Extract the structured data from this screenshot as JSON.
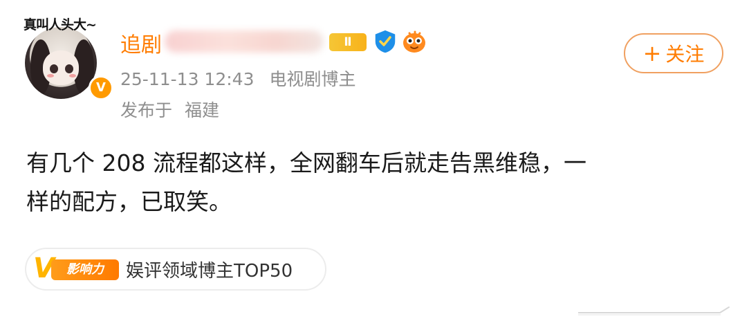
{
  "author": {
    "avatar_caption": "真叫人头大~",
    "verified_mark": "V",
    "name": "追剧",
    "level_badge": "Ⅱ",
    "badge_icons": [
      "shield-icon",
      "fish-icon"
    ]
  },
  "actions": {
    "follow_plus": "+",
    "follow_label": "关注"
  },
  "meta": {
    "timestamp": "25-11-13 12:43",
    "author_tag": "电视剧博主",
    "location_prefix": "发布于",
    "location": "福建"
  },
  "post": {
    "text": "有几个 208 流程都这样，全网翻车后就走告黑维稳，一\n样的配方，已取笑。"
  },
  "influence": {
    "badge_v": "V",
    "badge_label": "影响力",
    "text": "娱评领域博主TOP50"
  },
  "colors": {
    "accent": "#ff7c00",
    "meta_gray": "#8e8e8e",
    "body_text": "#1a1a1a"
  }
}
